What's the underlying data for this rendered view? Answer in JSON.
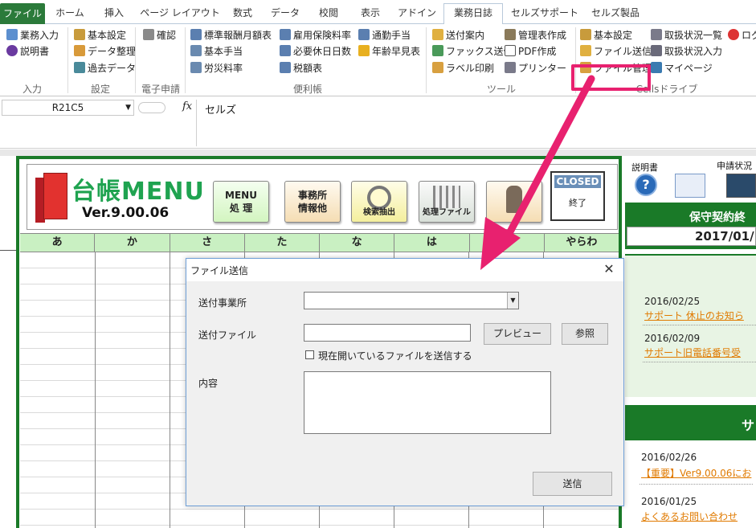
{
  "ribbon": {
    "tabs": [
      "ファイル",
      "ホーム",
      "挿入",
      "ページ レイアウト",
      "数式",
      "データ",
      "校閲",
      "表示",
      "アドイン",
      "業務日誌",
      "セルズサポート",
      "セルズ製品"
    ],
    "active_tab": "業務日誌",
    "groups": {
      "input": {
        "label": "入力",
        "items": [
          "業務入力",
          "説明書"
        ]
      },
      "settings": {
        "label": "設定",
        "items": [
          "基本設定",
          "データ整理",
          "過去データ"
        ]
      },
      "e_filing": {
        "label": "電子申請",
        "items": [
          "確認"
        ]
      },
      "handbook": {
        "label": "便利帳",
        "items": [
          "標準報酬月額表",
          "雇用保険料率",
          "通勤手当",
          "基本手当",
          "必要休日日数",
          "年齢早見表",
          "労災料率",
          "税額表"
        ]
      },
      "tools": {
        "label": "ツール",
        "items": [
          "送付案内",
          "管理表作成",
          "ファックス送信",
          "PDF作成",
          "ラベル印刷",
          "プリンター"
        ]
      },
      "cells_drive": {
        "label": "Cellsドライブ",
        "items": [
          "基本設定",
          "取扱状況一覧",
          "ログ",
          "ファイル送信",
          "取扱状況入力",
          "ファイル管理",
          "マイページ"
        ]
      }
    }
  },
  "formula_bar": {
    "name_box": "R21C5",
    "fx": "fx",
    "value": "セルズ"
  },
  "menu": {
    "title": "台帳MENU",
    "version": "Ver.9.00.06",
    "buttons": {
      "menu": "MENU\n処 理",
      "office": "事務所\n情報他",
      "search": "検索抽出",
      "files": "処理ファイル",
      "closed": "CLOSED",
      "exit": "終了"
    },
    "kana_columns": [
      "あ",
      "か",
      "さ",
      "た",
      "な",
      "は",
      "",
      "やらわ"
    ]
  },
  "right_panel": {
    "manual_label": "説明書",
    "status_label": "申請状況",
    "contract_label": "保守契約終",
    "contract_date": "2017/01/",
    "news_top": [
      {
        "date": "2016/02/25",
        "text": "サポート 休止のお知ら"
      },
      {
        "date": "2016/02/09",
        "text": "サポート旧電話番号受"
      }
    ],
    "section2_label": "サ",
    "news_bottom": [
      {
        "date": "2016/02/26",
        "text": "【重要】Ver9.00.06にお"
      },
      {
        "date": "2016/01/25",
        "text": "よくあるお問い合わせ"
      }
    ]
  },
  "dialog": {
    "title": "ファイル送信",
    "office_label": "送付事業所",
    "office_value": "",
    "file_label": "送付ファイル",
    "file_value": "",
    "preview_button": "プレビュー",
    "browse_button": "参照",
    "current_file_checkbox": "現在開いているファイルを送信する",
    "content_label": "内容",
    "content_value": "",
    "send_button": "送信"
  },
  "colors": {
    "excel_green": "#2b7a3a",
    "menu_green": "#1a7a28",
    "highlight": "#e8216f",
    "kana_bg": "#c9f0c2",
    "link_orange": "#e07a00"
  }
}
